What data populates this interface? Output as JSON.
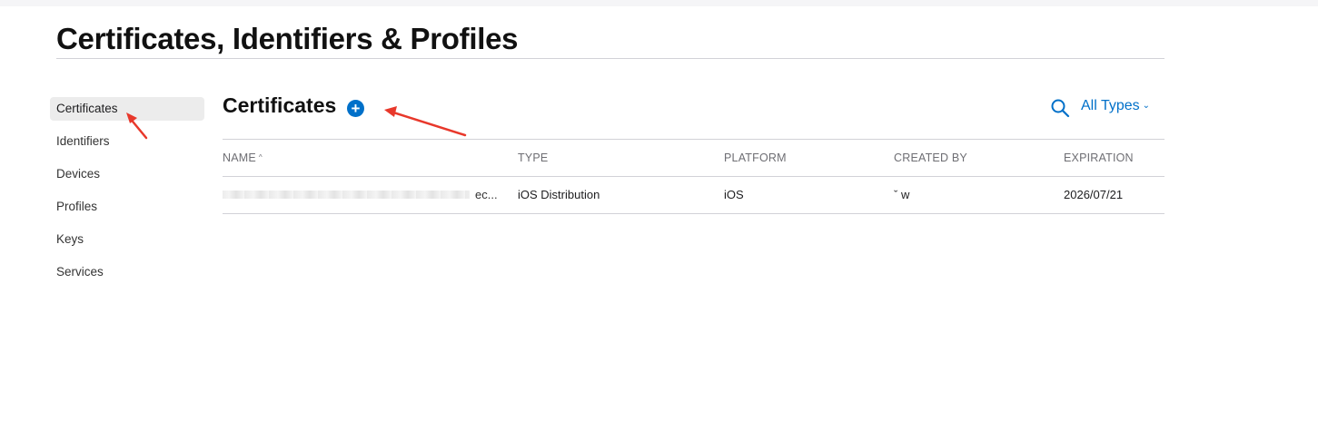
{
  "page": {
    "title": "Certificates, Identifiers & Profiles"
  },
  "sidebar": {
    "items": [
      {
        "label": "Certificates",
        "active": true
      },
      {
        "label": "Identifiers"
      },
      {
        "label": "Devices"
      },
      {
        "label": "Profiles"
      },
      {
        "label": "Keys"
      },
      {
        "label": "Services"
      }
    ]
  },
  "content": {
    "title": "Certificates",
    "add_icon": "plus-circle-icon",
    "search_icon": "search-icon",
    "filter_label": "All Types",
    "filter_icon": "chevron-down-icon"
  },
  "table": {
    "columns": [
      "NAME",
      "TYPE",
      "PLATFORM",
      "CREATED BY",
      "EXPIRATION"
    ],
    "sort_indicator": "^",
    "rows": [
      {
        "name_suffix": "ec...",
        "type": "iOS Distribution",
        "platform": "iOS",
        "created_by": "ˇ w",
        "expiration": "2026/07/21"
      }
    ]
  },
  "colors": {
    "accent": "#0070c9",
    "annotation_arrow": "#e8382b",
    "active_item_bg": "#ececec",
    "divider": "#d2d2d7"
  }
}
